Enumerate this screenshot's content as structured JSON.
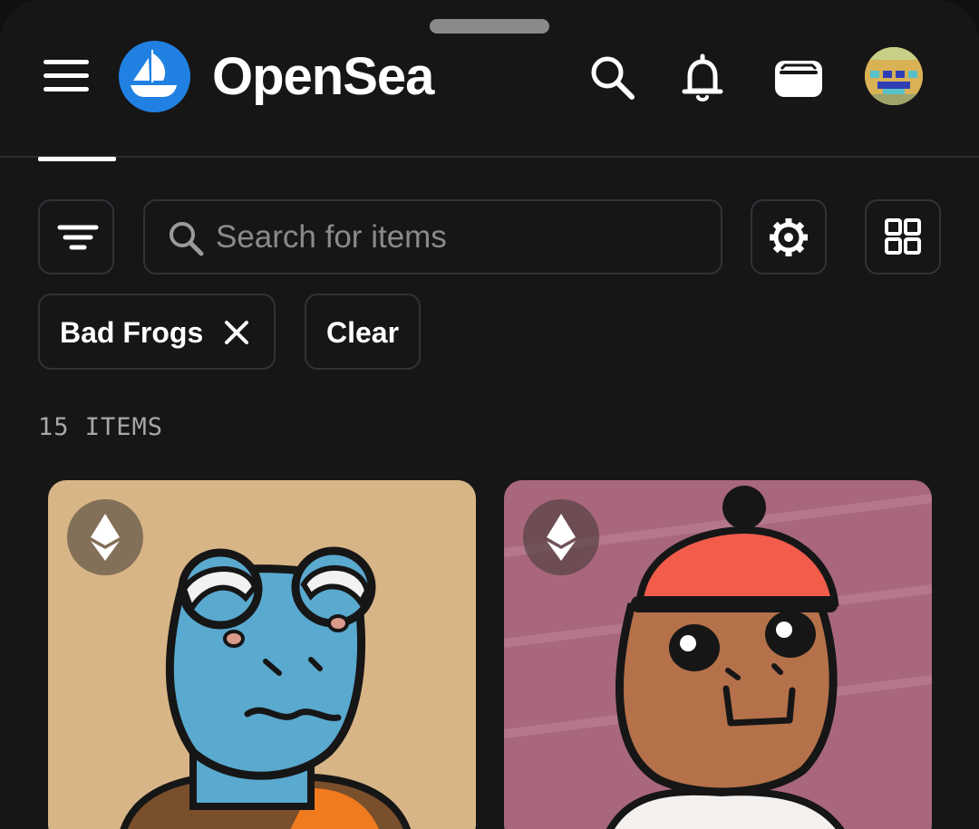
{
  "header": {
    "brand": "OpenSea",
    "icons": [
      "menu-icon",
      "opensea-logo-icon",
      "search-icon",
      "bell-icon",
      "wallet-icon",
      "avatar"
    ]
  },
  "toolbar": {
    "search_placeholder": "Search for items",
    "icons": [
      "filter-icon",
      "search-icon",
      "gear-icon",
      "grid-icon"
    ]
  },
  "filters": {
    "chips": [
      {
        "label": "Bad Frogs",
        "icon": "close-icon"
      }
    ],
    "clear_label": "Clear"
  },
  "results": {
    "count_label": "15 ITEMS"
  },
  "colors": {
    "background": "#161616",
    "border": "#303339",
    "brand_blue": "#2081E2",
    "muted_text": "#8a8a8a"
  },
  "items": [
    {
      "chain_icon": "ethereum-icon",
      "art": "blue-frog-bandage-icon",
      "bg": "#d8b587"
    },
    {
      "chain_icon": "ethereum-icon",
      "art": "brown-frog-red-beanie-icon",
      "bg": "#a8677d"
    }
  ]
}
